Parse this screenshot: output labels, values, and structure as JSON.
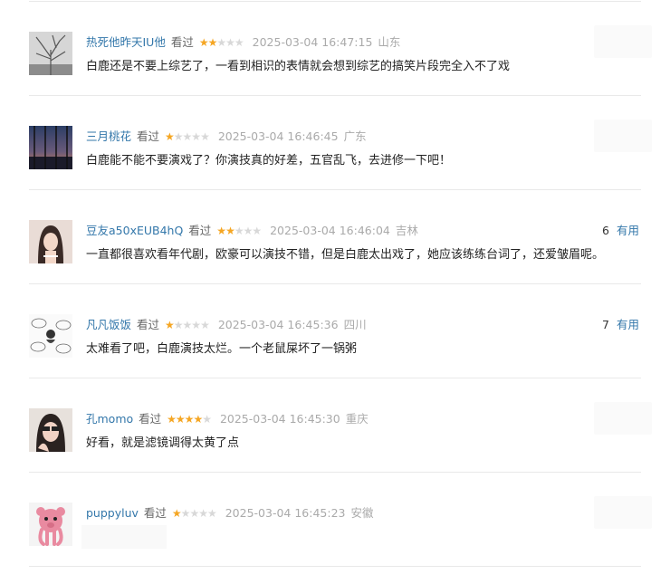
{
  "comments": [
    {
      "user": "热死他昨天IU他",
      "status": "看过",
      "stars": 2,
      "time": "2025-03-04 16:47:15",
      "location": "山东",
      "text": "白鹿还是不要上综艺了，一看到相识的表情就会想到综艺的搞笑片段完全入不了戏",
      "votes": "",
      "useful": ""
    },
    {
      "user": "三月桃花",
      "status": "看过",
      "stars": 1,
      "time": "2025-03-04 16:46:45",
      "location": "广东",
      "text": "白鹿能不能不要演戏了？你演技真的好差，五官乱飞，去进修一下吧！",
      "votes": "",
      "useful": ""
    },
    {
      "user": "豆友a50xEUB4hQ",
      "status": "看过",
      "stars": 2,
      "time": "2025-03-04 16:46:04",
      "location": "吉林",
      "text": "一直都很喜欢看年代剧，欧豪可以演技不错，但是白鹿太出戏了，她应该练练台词了，还爱皱眉呢。",
      "votes": "6",
      "useful": "有用"
    },
    {
      "user": "凡凡饭饭",
      "status": "看过",
      "stars": 1,
      "time": "2025-03-04 16:45:36",
      "location": "四川",
      "text": "太难看了吧，白鹿演技太烂。一个老鼠屎坏了一锅粥",
      "votes": "7",
      "useful": "有用"
    },
    {
      "user": "孔momo",
      "status": "看过",
      "stars": 4,
      "time": "2025-03-04 16:45:30",
      "location": "重庆",
      "text": "好看，就是滤镜调得太黄了点",
      "votes": "",
      "useful": ""
    },
    {
      "user": "puppyluv",
      "status": "看过",
      "stars": 1,
      "time": "2025-03-04 16:45:23",
      "location": "安徽",
      "text": "",
      "votes": "",
      "useful": ""
    }
  ],
  "star_max": 5,
  "colors": {
    "star_on": "#f5a623",
    "star_off": "#d8d8d8",
    "link": "#3377aa"
  },
  "icons": [
    "avatar-tree",
    "avatar-city",
    "avatar-girl",
    "avatar-doodle",
    "avatar-glasses",
    "avatar-pink-toy"
  ]
}
